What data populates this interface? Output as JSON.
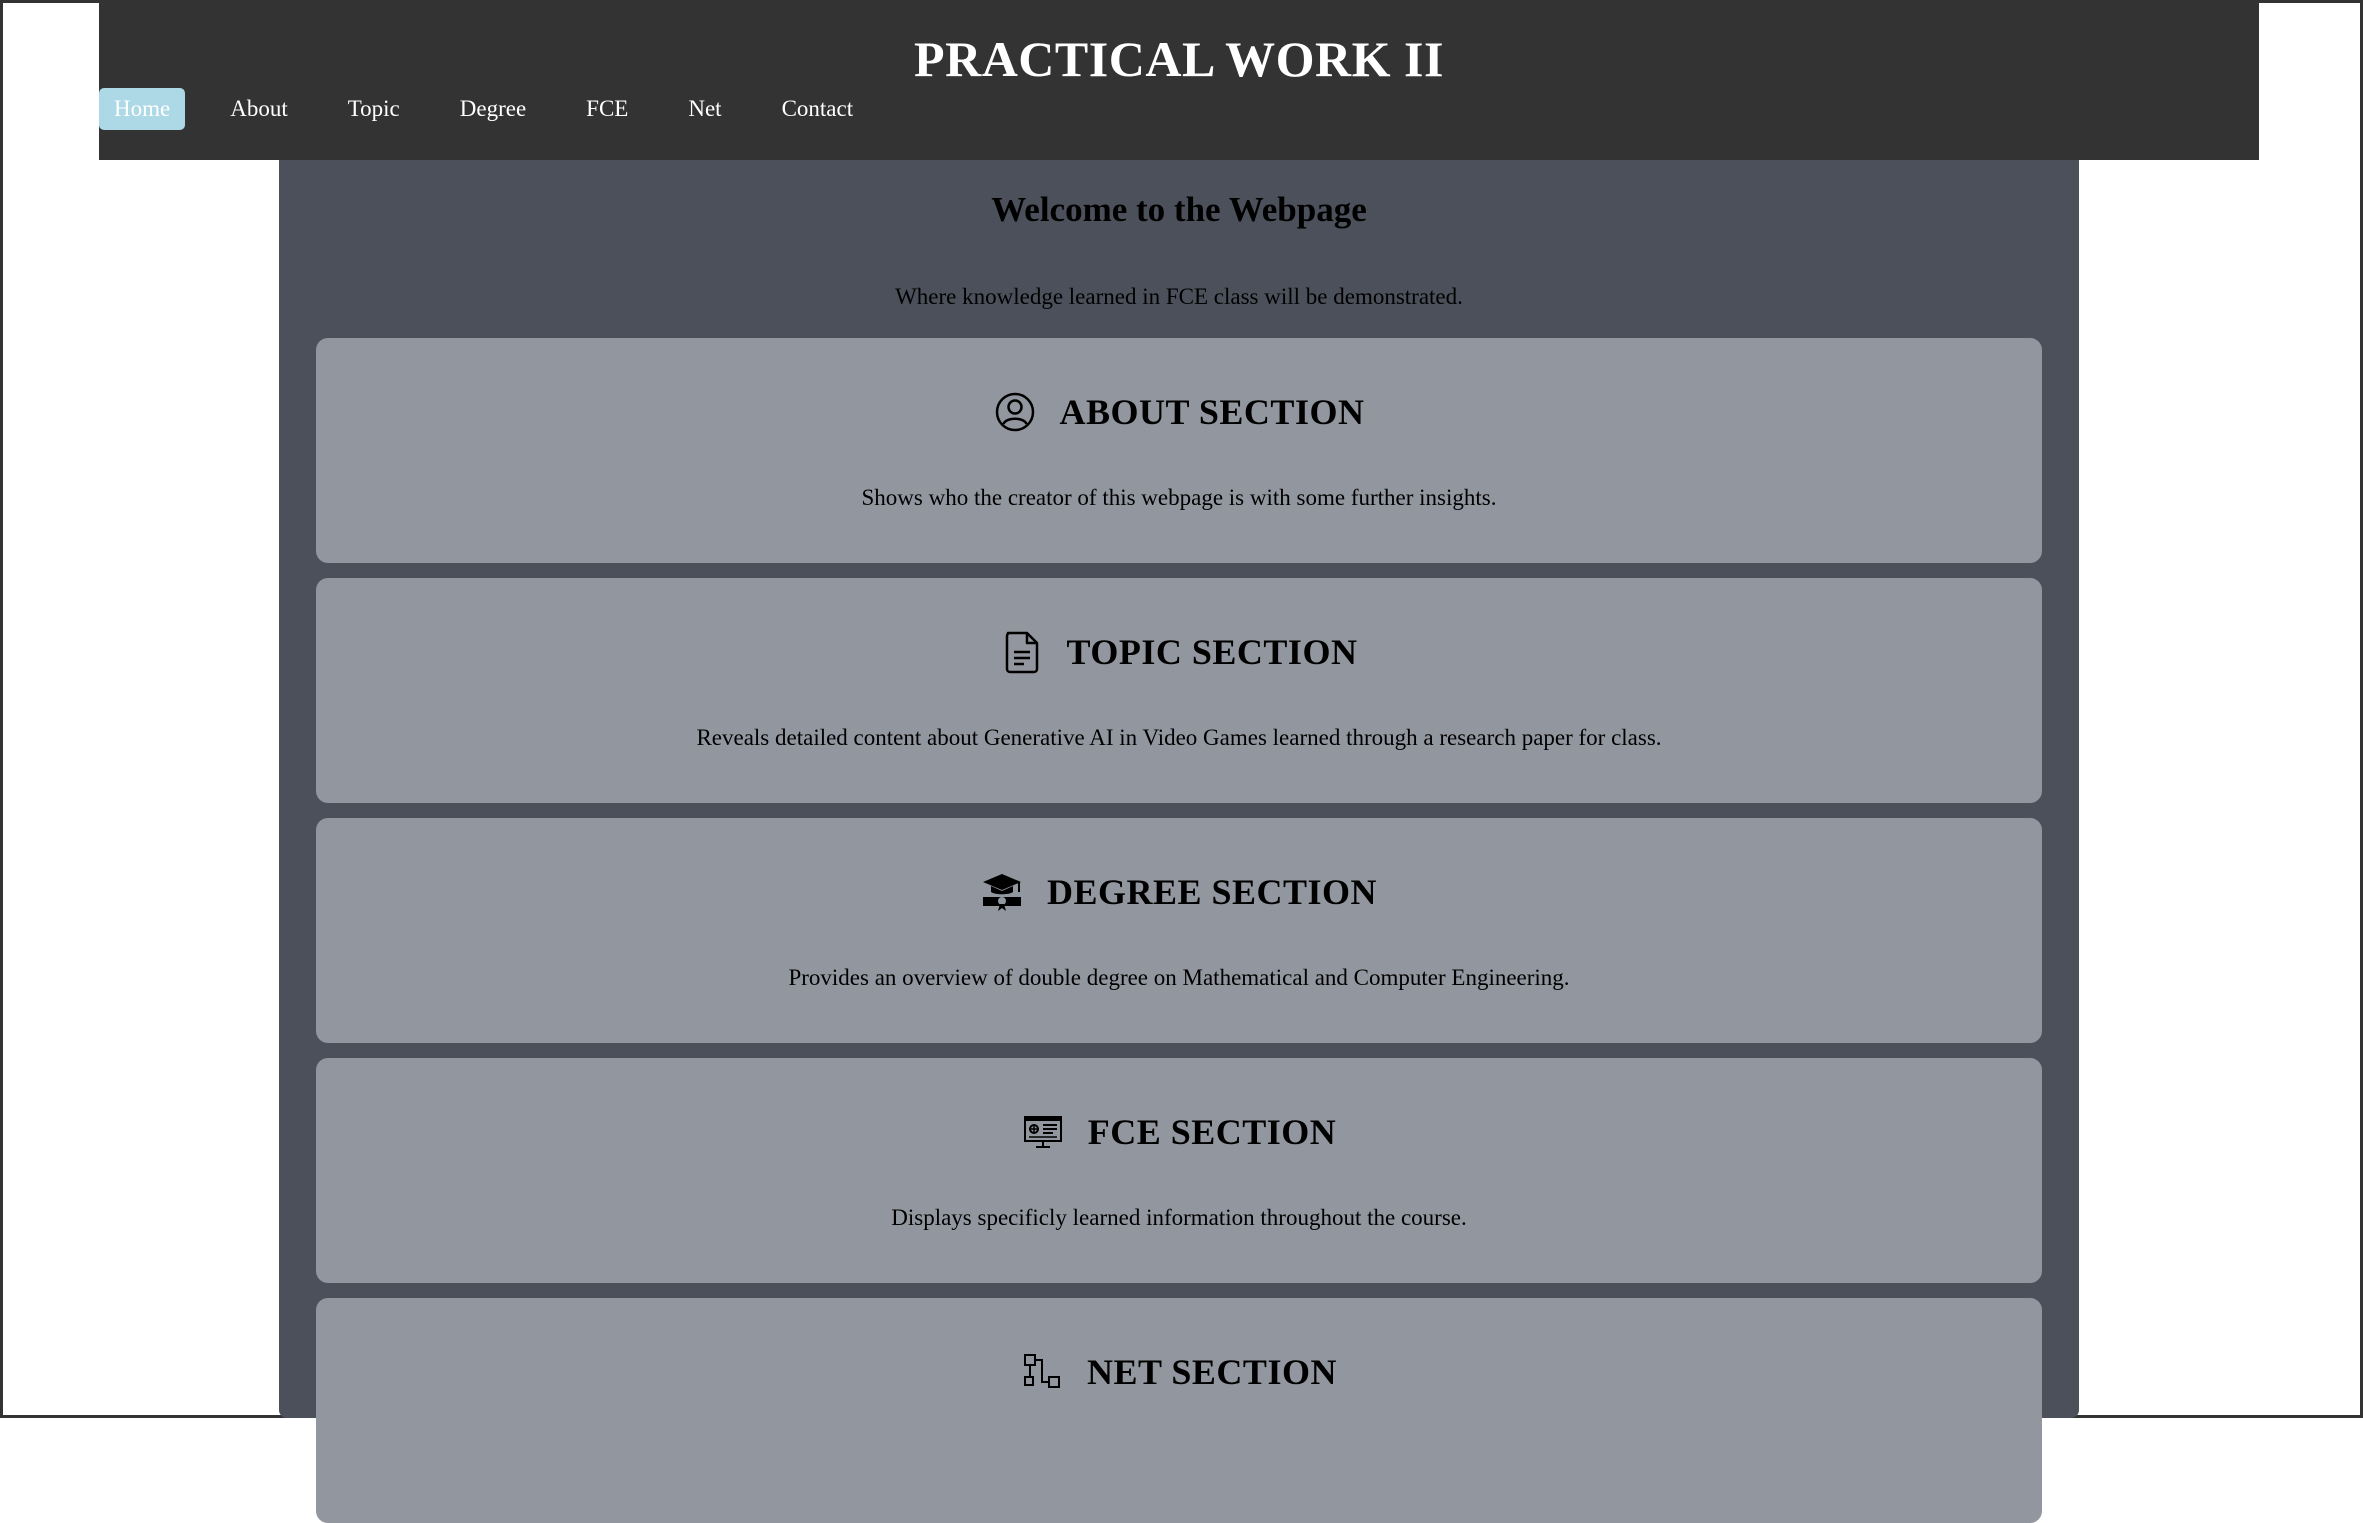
{
  "header": {
    "title": "PRACTICAL WORK II"
  },
  "nav": {
    "items": [
      {
        "label": "Home",
        "active": true
      },
      {
        "label": "About",
        "active": false
      },
      {
        "label": "Topic",
        "active": false
      },
      {
        "label": "Degree",
        "active": false
      },
      {
        "label": "FCE",
        "active": false
      },
      {
        "label": "Net",
        "active": false
      },
      {
        "label": "Contact",
        "active": false
      }
    ]
  },
  "main": {
    "title": "Welcome to the Webpage",
    "subtitle": "Where knowledge learned in FCE class will be demonstrated.",
    "sections": [
      {
        "icon": "user-circle-icon",
        "title": "ABOUT SECTION",
        "description": "Shows who the creator of this webpage is with some further insights."
      },
      {
        "icon": "document-icon",
        "title": "TOPIC SECTION",
        "description": "Reveals detailed content about Generative AI in Video Games learned through a research paper for class."
      },
      {
        "icon": "graduation-cap-icon",
        "title": "DEGREE SECTION",
        "description": "Provides an overview of double degree on Mathematical and Computer Engineering."
      },
      {
        "icon": "presentation-monitor-icon",
        "title": "FCE SECTION",
        "description": "Displays specificly learned information throughout the course."
      },
      {
        "icon": "network-icon",
        "title": "NET SECTION",
        "description": ""
      }
    ]
  },
  "colors": {
    "header_bg": "#333333",
    "nav_active_bg": "#add8e6",
    "main_bg": "#4b505a",
    "card_bg": "#92969e"
  }
}
